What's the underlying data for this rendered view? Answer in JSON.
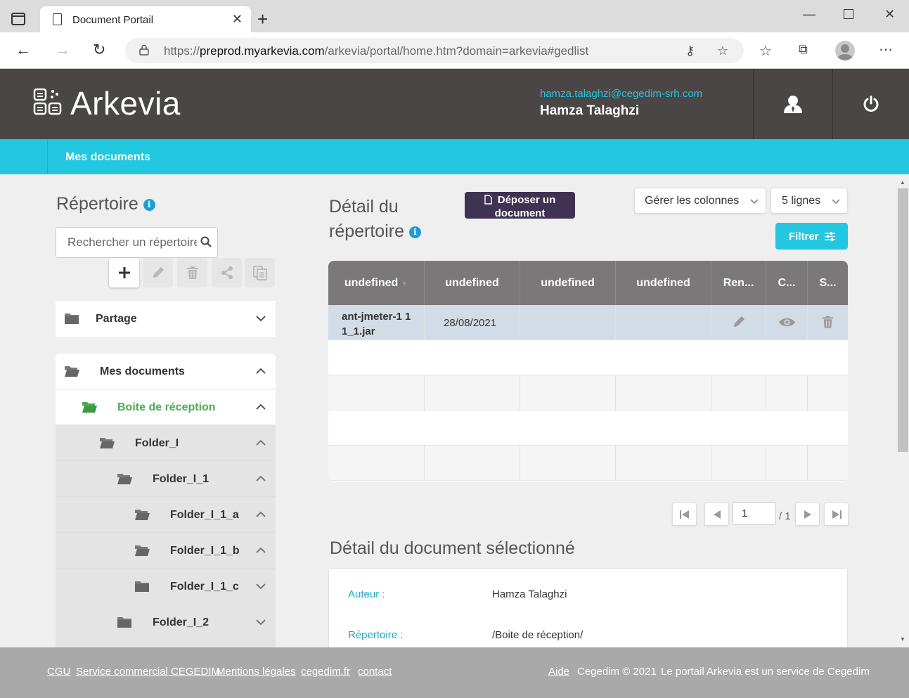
{
  "browser": {
    "tab_title": "Document Portail",
    "url_prefix": "https://",
    "url_host": "preprod.myarkevia.com",
    "url_path": "/arkevia/portal/home.htm?domain=arkevia#gedlist"
  },
  "header": {
    "logo": "Arkevia",
    "user_email": "hamza.talaghzi@cegedim-srh.com",
    "user_name": "Hamza Talaghzi"
  },
  "nav": {
    "mes_documents": "Mes documents"
  },
  "left": {
    "title": "Répertoire",
    "search_placeholder": "Rechercher un répertoire",
    "tree": {
      "partage": "Partage",
      "mes_documents": "Mes documents",
      "boite": "Boite de réception",
      "folders": [
        "Folder_I",
        "Folder_I_1",
        "Folder_I_1_a",
        "Folder_I_1_b",
        "Folder_I_1_c",
        "Folder_I_2"
      ]
    }
  },
  "right": {
    "title_line1": "Détail du",
    "title_line2": "répertoire",
    "deposer_line1": "Déposer un",
    "deposer_line2": "document",
    "gerer_colonnes": "Gérer les colonnes",
    "lignes": "5 lignes",
    "filtrer": "Filtrer",
    "columns": [
      "undefined",
      "undefined",
      "undefined",
      "undefined",
      "Ren...",
      "C...",
      "S..."
    ],
    "rows": [
      {
        "name_line1": "ant-jmeter-1 1",
        "name_line2": "1_1.jar",
        "date": "28/08/2021"
      }
    ],
    "pager": {
      "page": "1",
      "total": "/ 1"
    }
  },
  "doc_detail": {
    "title": "Détail du document sélectionné",
    "auteur_label": "Auteur :",
    "auteur_value": "Hamza Talaghzi",
    "repertoire_label": "Répertoire :",
    "repertoire_value": "/Boite de réception/"
  },
  "footer": {
    "cgu": "CGU",
    "service": "Service commercial CEGEDIM",
    "mentions": "Mentions légales",
    "cegedim_fr": "cegedim.fr",
    "contact": "contact",
    "aide": "Aide",
    "copyright": "Cegedim © 2021",
    "tagline": "Le portail Arkevia est un service de Cegedim"
  },
  "colors": {
    "accent": "#23c7e0",
    "header_bg": "#4a4646",
    "deposer_bg": "#3f3252",
    "green": "#4aad52"
  }
}
